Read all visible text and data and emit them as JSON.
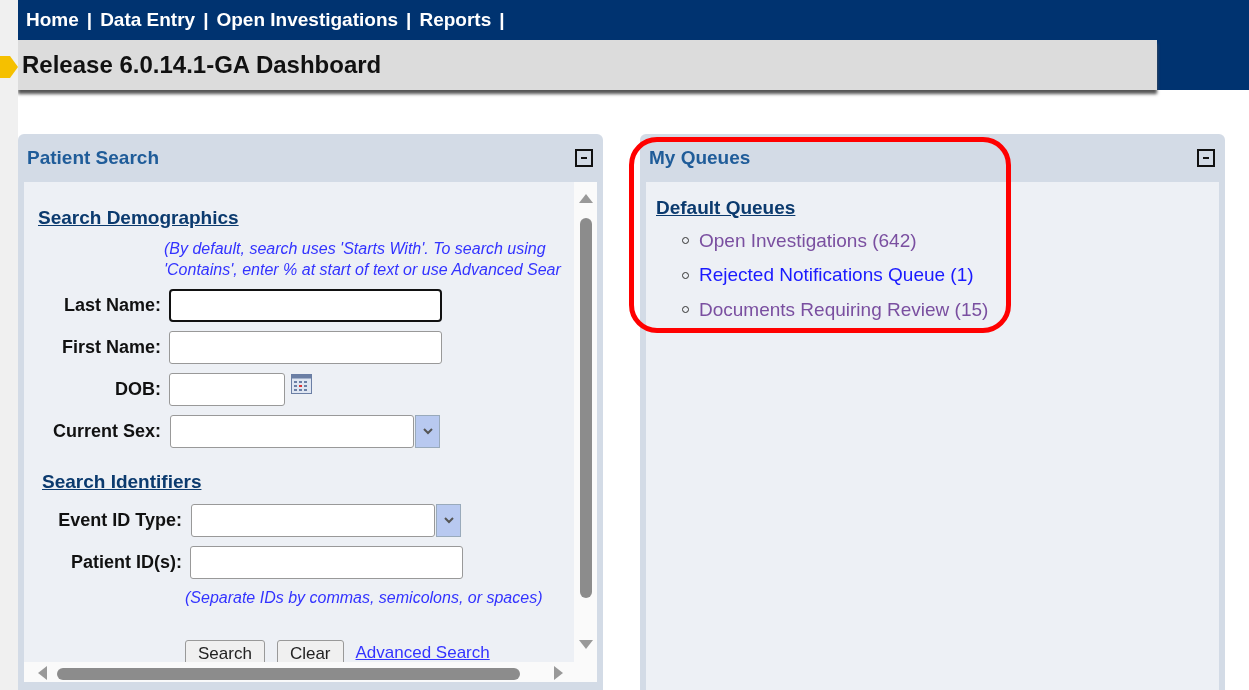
{
  "nav": {
    "links": [
      "Home",
      "Data Entry",
      "Open Investigations",
      "Reports"
    ],
    "separator": "|"
  },
  "page_title": "Release 6.0.14.1-GA Dashboard",
  "patient_search": {
    "title": "Patient Search",
    "demographics": {
      "heading": "Search Demographics",
      "hint_lines": [
        "(By default, search uses 'Starts With'. To search using",
        "'Contains', enter % at start of text or use Advanced Sear"
      ],
      "fields": [
        {
          "label": "Last Name:",
          "kind": "text",
          "focused": true
        },
        {
          "label": "First Name:",
          "kind": "text",
          "focused": false
        },
        {
          "label": "DOB:",
          "kind": "date",
          "focused": false
        },
        {
          "label": "Current Sex:",
          "kind": "select",
          "focused": false
        }
      ]
    },
    "identifiers": {
      "heading": "Search Identifiers",
      "fields": [
        {
          "label": "Event ID Type:",
          "kind": "select",
          "focused": false
        },
        {
          "label": "Patient ID(s):",
          "kind": "wide",
          "focused": false
        }
      ],
      "hint": "(Separate IDs by commas, semicolons, or spaces)"
    },
    "buttons": [
      "Search",
      "Clear"
    ],
    "advanced_link": "Advanced Search"
  },
  "my_queues": {
    "title": "My Queues",
    "heading": "Default Queues",
    "items": [
      {
        "label": "Open Investigations (642)",
        "visited": true
      },
      {
        "label": "Rejected Notifications Queue (1)",
        "visited": false
      },
      {
        "label": "Documents Requiring Review (15)",
        "visited": true
      }
    ]
  }
}
